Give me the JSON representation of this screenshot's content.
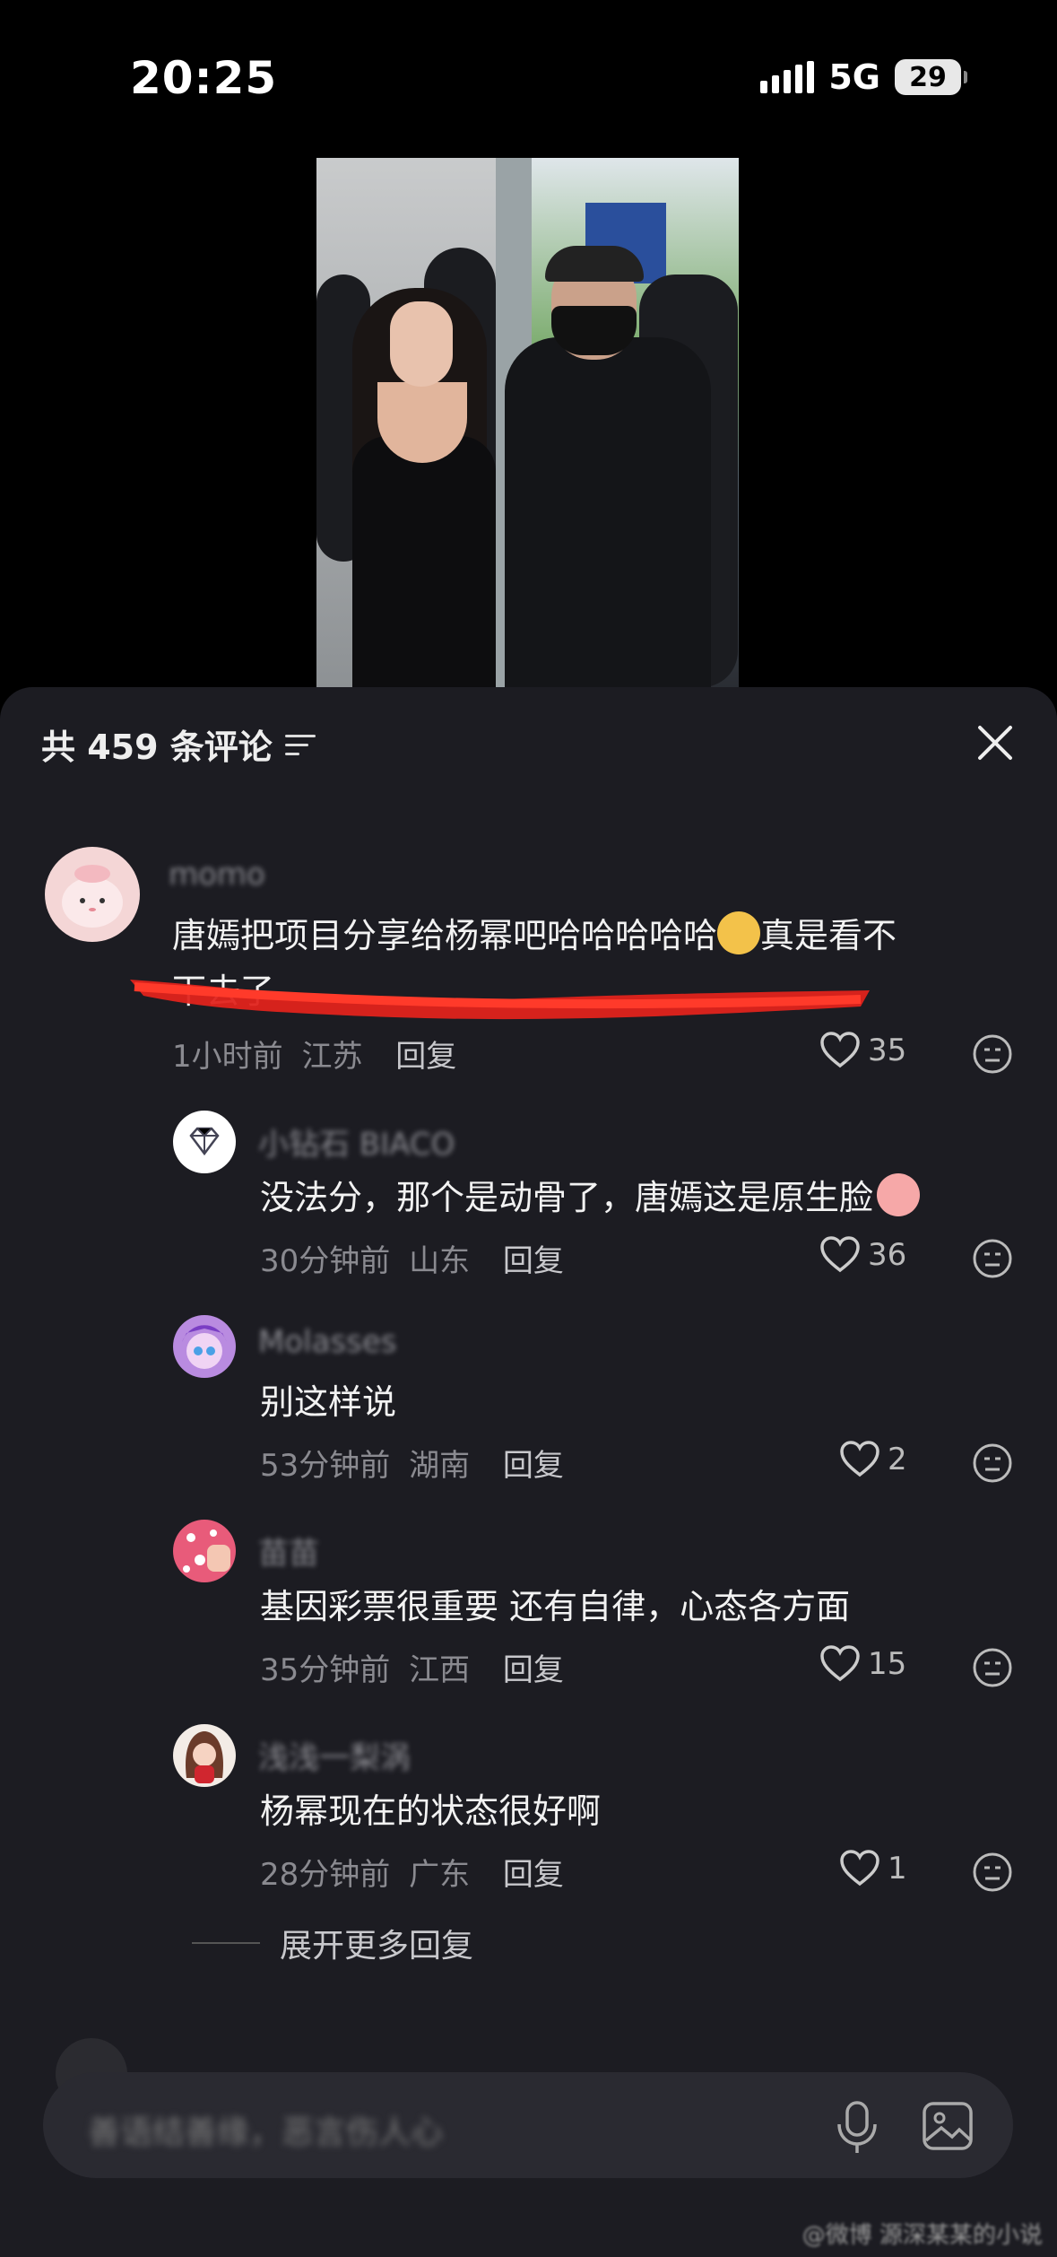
{
  "status_bar": {
    "time": "20:25",
    "network": "5G",
    "battery_level": "29"
  },
  "comments_panel": {
    "title": "共 459 条评论",
    "comments": [
      {
        "username": "momo",
        "avatar_color": "#f4d6d6",
        "text_line1": "唐嫣把项目分享给杨幂吧哈哈哈哈哈",
        "text_after_emoji": "真是看不",
        "text_line2": "下去了",
        "time": "1小时前",
        "location": "江苏",
        "reply_label": "回复",
        "likes": "35"
      },
      {
        "username": "小钻石 BIACO",
        "avatar_color": "#ffffff",
        "avatar_icon": "diamond-icon",
        "text": "没法分，那个是动骨了，唐嫣这是原生脸",
        "time": "30分钟前",
        "location": "山东",
        "reply_label": "回复",
        "likes": "36"
      },
      {
        "username": "Molasses",
        "avatar_color": "#b98be0",
        "text": "别这样说",
        "time": "53分钟前",
        "location": "湖南",
        "reply_label": "回复",
        "likes": "2"
      },
      {
        "username": "苗苗",
        "avatar_color": "#e85b7a",
        "text": "基因彩票很重要 还有自律，心态各方面",
        "time": "35分钟前",
        "location": "江西",
        "reply_label": "回复",
        "likes": "15"
      },
      {
        "username": "浅浅一梨涡",
        "avatar_color": "#f3ece6",
        "text": "杨幂现在的状态很好啊",
        "time": "28分钟前",
        "location": "广东",
        "reply_label": "回复",
        "likes": "1"
      }
    ],
    "expand_more": "展开更多回复"
  },
  "input_bar": {
    "placeholder": "善语结善缘，恶言伤人心"
  },
  "watermark": "@微博 源深某某的小说",
  "colors": {
    "sheet_bg": "#1c1c22",
    "scribble": "#e0231c",
    "text_primary": "#f2f2f2",
    "text_secondary": "#8a8a90"
  }
}
